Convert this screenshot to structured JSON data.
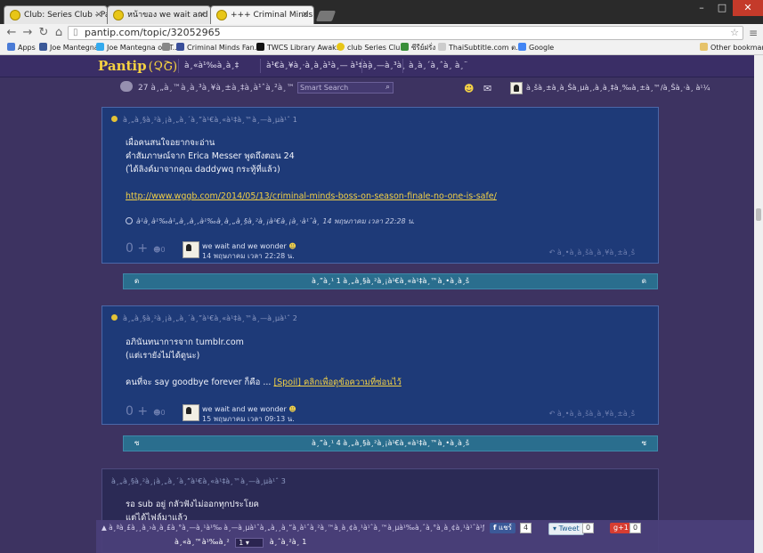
{
  "browser": {
    "tabs": [
      {
        "label": "Club: Series Club - Pantip"
      },
      {
        "label": "หน้าของ we wait and we w"
      },
      {
        "label": "+++ Criminal Minds #57"
      }
    ],
    "url": "pantip.com/topic/32052965",
    "bookmarks": [
      {
        "label": "Apps"
      },
      {
        "label": "Joe Mantegna"
      },
      {
        "label": "Joe Mantegna on T..."
      },
      {
        "label": ""
      },
      {
        "label": "Criminal Minds Fan..."
      },
      {
        "label": "TWCS Library  Awak..."
      },
      {
        "label": "club Series Club"
      },
      {
        "label": "ซีรีย์ฝรั่ง"
      },
      {
        "label": "ThaiSubtitle.com  ต..."
      },
      {
        "label": "Google"
      }
    ],
    "other_bookmarks": "Other bookmarks"
  },
  "site": {
    "logo": "Pantip",
    "nav": [
      "à¸«à¹‰à¸­à¸‡",
      "à¹€à¸¥à¸·à¸­à¸à¹à¸— à¹‡à¸",
      "à¸—à¸³à¸",
      "à¸à¸´à¸ˆà¸ à¸¨"
    ],
    "viewers": "27 à¸„à¸™à¸à¸³à¸¥à¸±à¸‡à¸­à¹ˆà¸²à¸™",
    "search_placeholder": "Smart Search",
    "user_label": "à¸šà¸±à¸à¸Šà¸µà¸‚à¸­à¸‡à¸‰à¸±à¸™/à¸Šà¸·à¸­ à¹¼"
  },
  "posts": [
    {
      "header": "à¸„à¸§à¸²à¸¡à¸„à¸´à¸”à¹€à¸«à¹‡à¸™à¸—à¸µà¹ˆ 1",
      "lines": [
        "เผื่อคนสนใจอยากจะอ่าน",
        "คำสัมภาษณ์จาก Erica Messer พูดถึงตอน 24",
        "(ได้ลิงค์มาจากคุณ daddywq กระทู้ที่แล้ว)"
      ],
      "link": "http://www.wggb.com/2014/05/13/criminal-minds-boss-on-season-finale-no-one-is-safe/",
      "edited": "à¹à¸à¹‰à¹„à¸‚à¸‚à¹‰à¸­à¸„à¸§à¸²à¸¡à¹€à¸¡à¸·à¹ˆà¸­ 14 พฤษภาคม เวลา 22:28 น.",
      "vote": "0",
      "emo": "0",
      "author": "we wait and we wonder",
      "time": "14 พฤษภาคม เวลา 22:28 น.",
      "reply": "à¸•à¸­à¸šà¸à¸¥à¸±à¸š"
    },
    {
      "header": "à¸„à¸§à¸²à¸¡à¸„à¸´à¸”à¹€à¸«à¹‡à¸™à¸—à¸µà¹ˆ 2",
      "lines": [
        "อภินันทนาการจาก tumblr.com",
        "(แต่เรายังไม่ได้ดูนะ)"
      ],
      "body2": "คนที่จะ say goodbye forever ก็คือ ...",
      "spoiler": "[Spoil] คลิกเพื่อดูข้อความที่ซ่อนไว้",
      "vote": "0",
      "emo": "0",
      "author": "we wait and we wonder",
      "time": "15 พฤษภาคม เวลา 09:13 น.",
      "reply": "à¸•à¸­à¸šà¸à¸¥à¸±à¸š"
    },
    {
      "header": "à¸„à¸§à¸²à¸¡à¸„à¸´à¸”à¹€à¸«à¹‡à¸™à¸—à¸µà¹ˆ 3",
      "lines": [
        "รอ sub อยู่ กลัวฟังไม่ออกทุกประโยค",
        "แต่ได้ไฟล์มาแล้ว"
      ]
    }
  ],
  "reply_bars": [
    {
      "left": "ด",
      "text": "à¸”à¸¹ 1 à¸„à¸§à¸²à¸¡à¹€à¸«à¹‡à¸™à¸•à¸­à¸š",
      "right": "ด"
    },
    {
      "left": "ซ",
      "text": "à¸”à¸¹ 4 à¸„à¸§à¸²à¸¡à¹€à¸«à¹‡à¸™à¸•à¸­à¸š",
      "right": "ซ"
    }
  ],
  "bottom": {
    "crumbs": "à¸ªà¸£à¸¸à¸›à¸à¸£à¸°à¸—à¸¹à¹‰ à¸—à¸µà¹ˆà¸„à¸¸à¸“à¸­à¹ˆà¸²à¸™à¸­à¸¢à¸¹à¹ˆà¸™à¸µà¹‰à¸ˆà¸°à¸­à¸¢à¸¹à¹ˆà¹ƒà¸™à¸«à¸™à¹‰à¸²à¹à¸£à¸...",
    "fb_label": "แชร์",
    "fb_count": "4",
    "tweet_label": "Tweet",
    "tweet_count": "0",
    "gplus_label": "g+1",
    "gplus_count": "0",
    "page_label": "à¸«à¸™à¹‰à¸²",
    "page_value": "1",
    "page_total": "à¸ˆà¸²à¸ 1"
  },
  "colors": {
    "accent": "#f5d142",
    "post_bg": "#1e3a78",
    "page_bg": "#3d3361",
    "reply_bar": "#2a6e8e"
  }
}
